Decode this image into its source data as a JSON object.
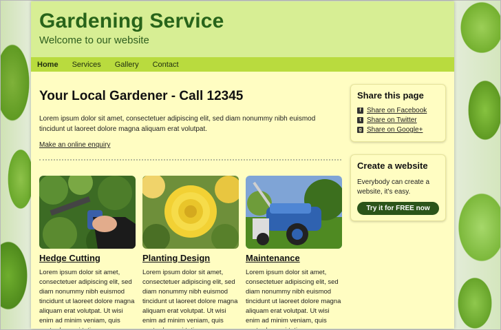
{
  "header": {
    "title": "Gardening Service",
    "tagline": "Welcome to our website"
  },
  "nav": {
    "items": [
      {
        "label": "Home"
      },
      {
        "label": "Services"
      },
      {
        "label": "Gallery"
      },
      {
        "label": "Contact"
      }
    ]
  },
  "main": {
    "heading": "Your Local Gardener - Call 12345",
    "intro": "Lorem ipsum dolor sit amet, consectetuer adipiscing elit, sed diam nonummy nibh euismod tincidunt ut laoreet dolore magna aliquam erat volutpat.",
    "enquiry_link": "Make an online enquiry",
    "cards": [
      {
        "title": "Hedge Cutting",
        "text": "Lorem ipsum dolor sit amet, consectetuer adipiscing elit, sed diam nonummy nibh euismod tincidunt ut laoreet dolore magna aliquam erat volutpat. Ut wisi enim ad minim veniam, quis nostrud exerci tation"
      },
      {
        "title": "Planting Design",
        "text": "Lorem ipsum dolor sit amet, consectetuer adipiscing elit, sed diam nonummy nibh euismod tincidunt ut laoreet dolore magna aliquam erat volutpat. Ut wisi enim ad minim veniam, quis nostrud exerci tation"
      },
      {
        "title": "Maintenance",
        "text": "Lorem ipsum dolor sit amet, consectetuer adipiscing elit, sed diam nonummy nibh euismod tincidunt ut laoreet dolore magna aliquam erat volutpat. Ut wisi enim ad minim veniam, quis nostrud exerci tation"
      }
    ]
  },
  "sidebar": {
    "share": {
      "heading": "Share this page",
      "links": [
        {
          "icon": "facebook-icon",
          "label": "Share on Facebook"
        },
        {
          "icon": "twitter-icon",
          "label": "Share on Twitter"
        },
        {
          "icon": "googleplus-icon",
          "label": "Share on Google+"
        }
      ]
    },
    "create": {
      "heading": "Create a website",
      "text": "Everybody can create a website, it's easy.",
      "button": "Try it for FREE now"
    }
  },
  "colors": {
    "header_bg": "#d7ee94",
    "nav_bg": "#b9db3e",
    "page_bg": "#fffdc2",
    "title": "#28641a",
    "button": "#2b5419"
  }
}
